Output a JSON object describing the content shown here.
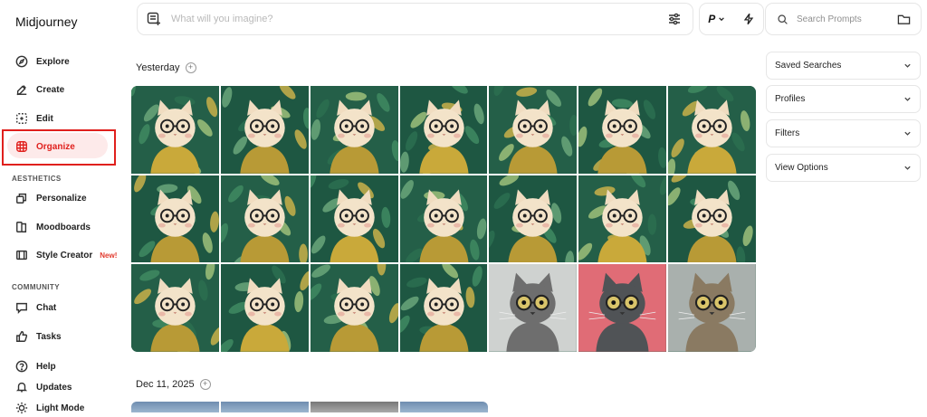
{
  "app": {
    "title": "Midjourney"
  },
  "sidebar": {
    "items": [
      {
        "label": "Explore",
        "icon": "compass-icon"
      },
      {
        "label": "Create",
        "icon": "brush-icon"
      },
      {
        "label": "Edit",
        "icon": "edit-icon"
      },
      {
        "label": "Organize",
        "icon": "grid-icon",
        "active": true
      }
    ],
    "aesthetics_heading": "AESTHETICS",
    "aesthetics": [
      {
        "label": "Personalize",
        "icon": "layers-icon"
      },
      {
        "label": "Moodboards",
        "icon": "moodboard-icon"
      },
      {
        "label": "Style Creator",
        "icon": "style-creator-icon",
        "badge": "New!"
      }
    ],
    "community_heading": "COMMUNITY",
    "community": [
      {
        "label": "Chat",
        "icon": "chat-icon"
      },
      {
        "label": "Tasks",
        "icon": "thumbs-up-icon"
      }
    ],
    "bottom": [
      {
        "label": "Help",
        "icon": "help-icon"
      },
      {
        "label": "Updates",
        "icon": "bell-icon"
      },
      {
        "label": "Light Mode",
        "icon": "sun-icon"
      }
    ]
  },
  "topbar": {
    "prompt_placeholder": "What will you imagine?",
    "mode_label": "P",
    "search_placeholder": "Search Prompts"
  },
  "main": {
    "groups": [
      {
        "date": "Yesterday",
        "add": "+"
      },
      {
        "date": "Dec 11, 2025",
        "add": "+"
      }
    ]
  },
  "right_panel": {
    "sections": [
      "Saved Searches",
      "Profiles",
      "Filters",
      "View Options"
    ]
  },
  "colors": {
    "accent": "#e0201d",
    "active_bg": "#fdeaea",
    "jungle": "#1f5a45"
  }
}
